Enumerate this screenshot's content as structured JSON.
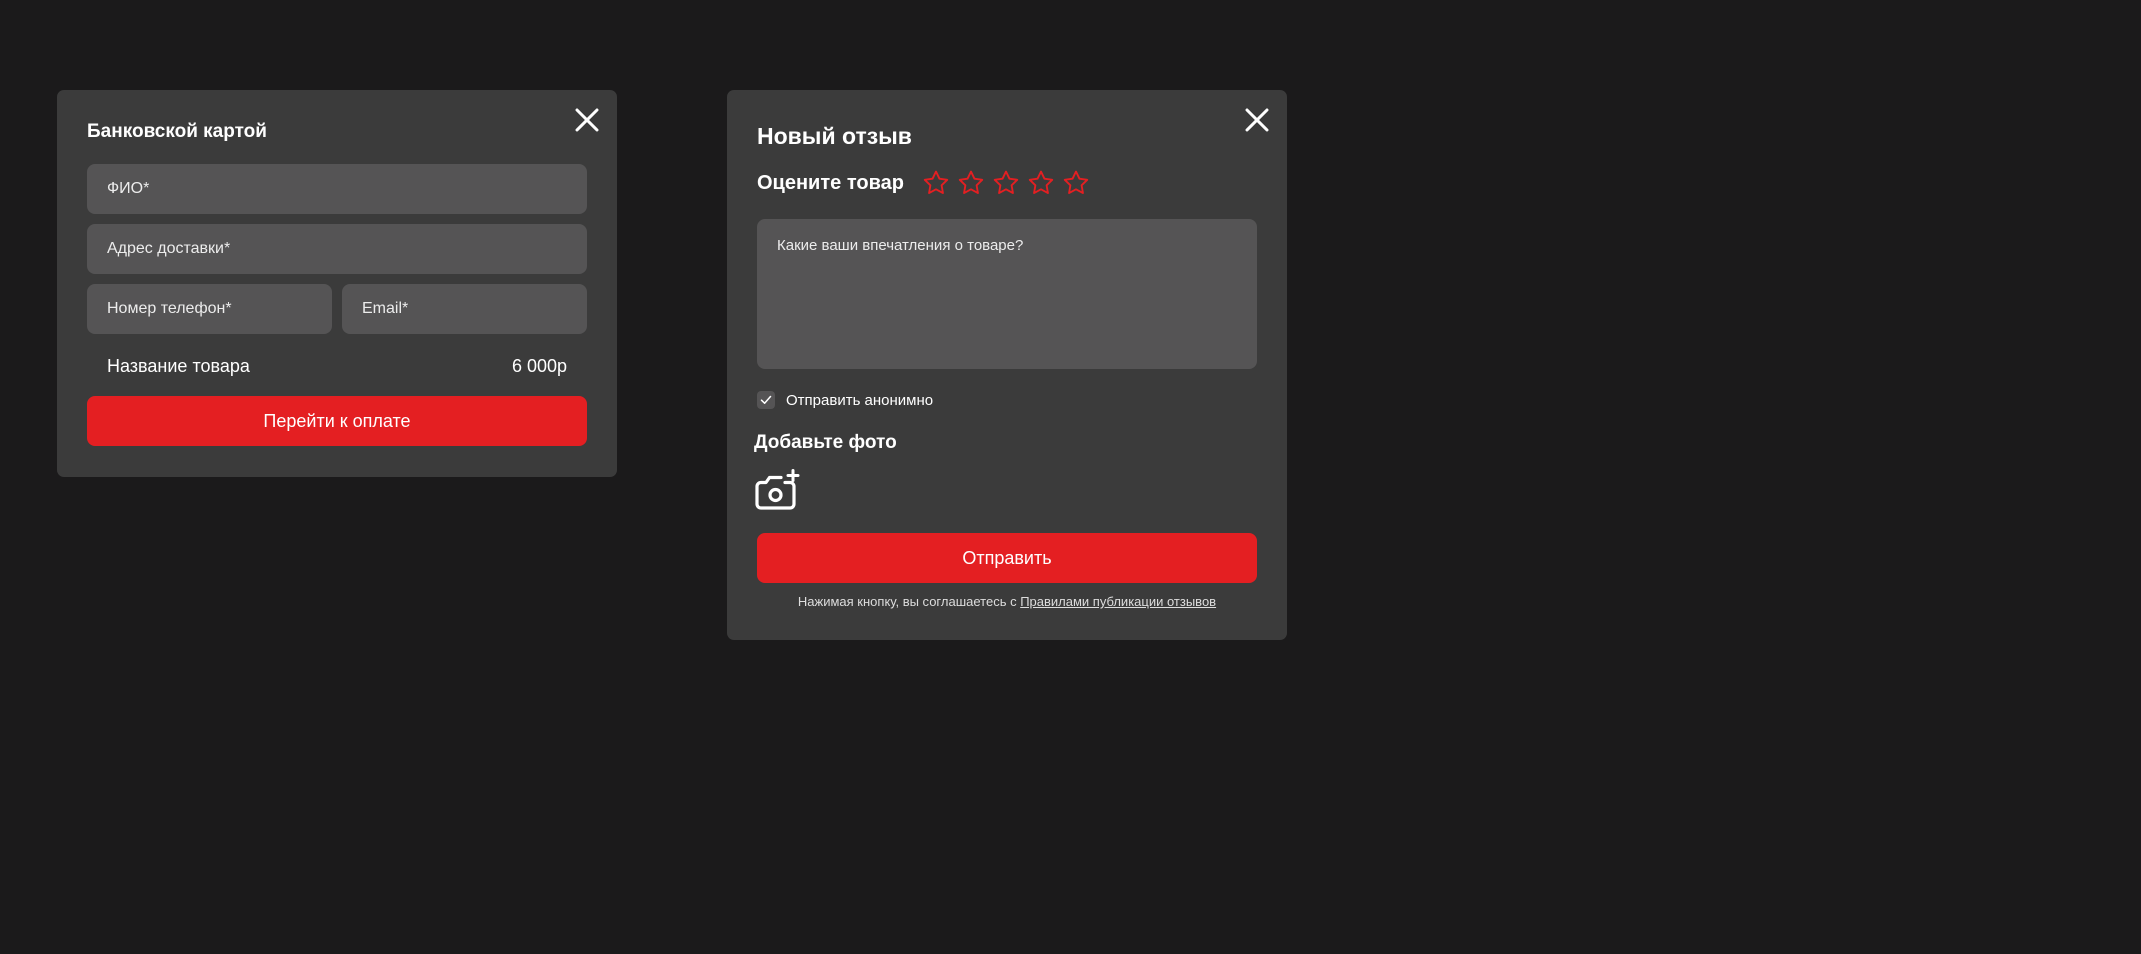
{
  "colors": {
    "background": "#1b1a1b",
    "modal": "#3b3b3b",
    "field": "#555455",
    "accent": "#e41f22",
    "text": "#ffffff"
  },
  "payment": {
    "title": "Банковской картой",
    "close_icon": "close-icon",
    "fields": {
      "fio_placeholder": "ФИО*",
      "address_placeholder": "Адрес доставки*",
      "phone_placeholder": "Номер телефон*",
      "email_placeholder": "Email*"
    },
    "product": {
      "name": "Название товара",
      "price": "6 000р"
    },
    "pay_button": "Перейти к оплате"
  },
  "review": {
    "title": "Новый отзыв",
    "close_icon": "close-icon",
    "rate_label": "Оцените товар",
    "rating": {
      "value": 0,
      "max": 5,
      "icon": "star-outline-icon"
    },
    "textarea_placeholder": "Какие ваши впечатления о товаре?",
    "anonymous": {
      "label": "Отправить анонимно",
      "checked": true
    },
    "photo_title": "Добавьте фото",
    "photo_icon": "add-photo-camera-icon",
    "submit_button": "Отправить",
    "agreement": {
      "text": "Нажимая кнопку, вы соглашаетесь с ",
      "link": "Правилами публикации отзывов"
    }
  }
}
